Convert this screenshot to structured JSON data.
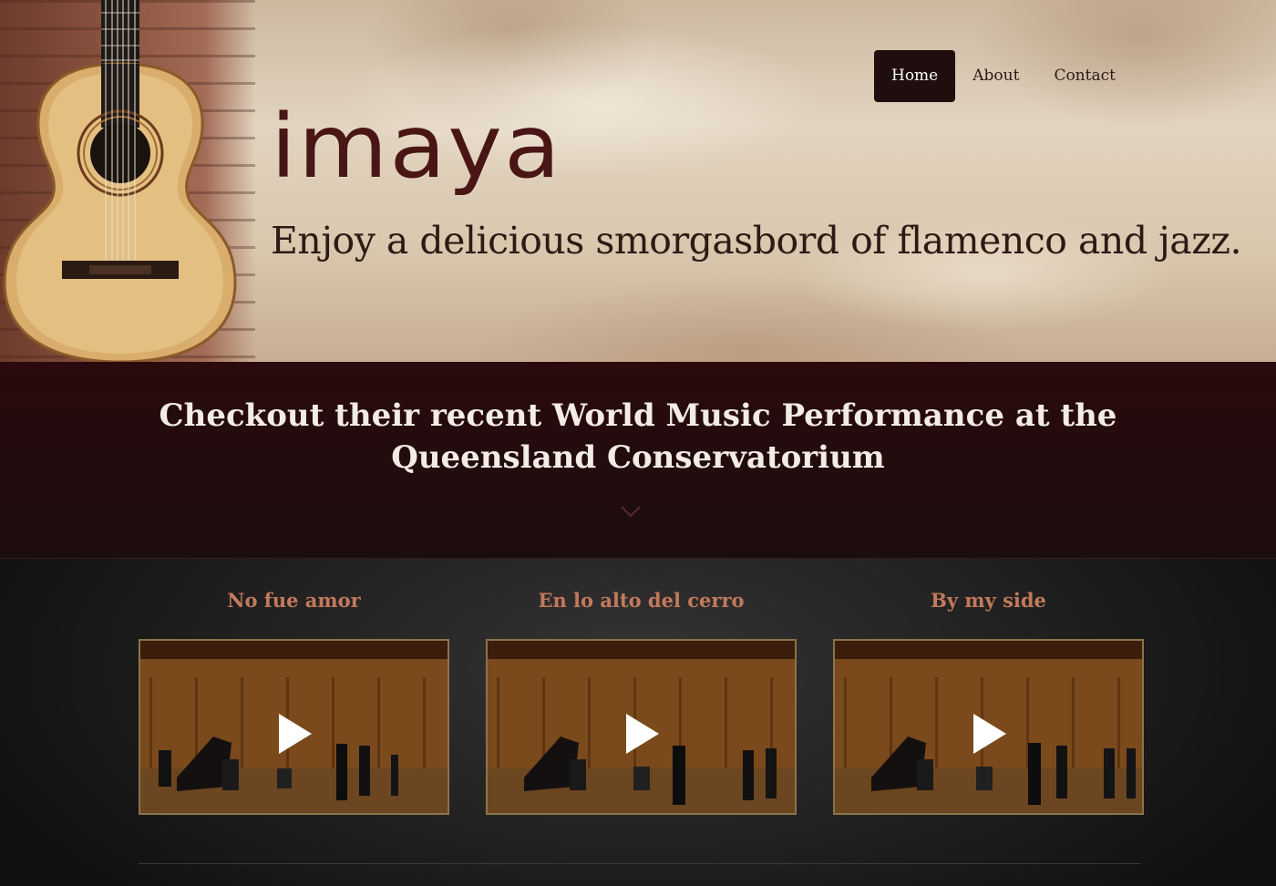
{
  "nav": {
    "items": [
      {
        "label": "Home",
        "active": true
      },
      {
        "label": "About",
        "active": false
      },
      {
        "label": "Contact",
        "active": false
      }
    ]
  },
  "hero": {
    "brand": "imaya",
    "tagline": "Enjoy a delicious smorgasbord of flamenco and jazz."
  },
  "banner": {
    "title": "Checkout their recent World Music Performance at the Queensland Conservatorium",
    "icon": "chevron-down-icon"
  },
  "videos": [
    {
      "title": "No fue amor",
      "icon": "play-icon"
    },
    {
      "title": "En lo alto del cerro",
      "icon": "play-icon"
    },
    {
      "title": "By my side",
      "icon": "play-icon"
    }
  ],
  "colors": {
    "nav_active_bg": "#1f0e0e",
    "brand": "#4a1515",
    "banner_bg": "#210c0e",
    "video_title": "#c27a5c",
    "thumb_border": "#8b7449"
  }
}
